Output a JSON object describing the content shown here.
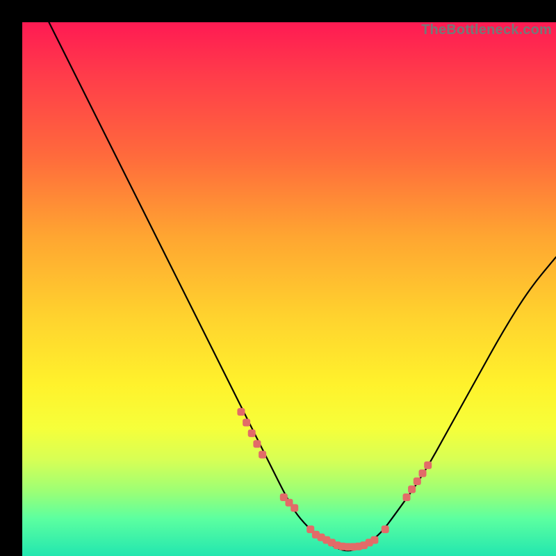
{
  "watermark": "TheBottleneck.com",
  "colors": {
    "background": "#000000",
    "curve": "#000000",
    "markers": "#e26b68",
    "gradient_top": "#ff1a53",
    "gradient_bottom": "#22e6b0"
  },
  "chart_data": {
    "type": "line",
    "title": "",
    "xlabel": "",
    "ylabel": "",
    "xlim": [
      0,
      100
    ],
    "ylim": [
      0,
      100
    ],
    "series": [
      {
        "name": "bottleneck-curve",
        "x": [
          5,
          10,
          15,
          20,
          25,
          30,
          35,
          40,
          45,
          50,
          52,
          55,
          58,
          60,
          62,
          64,
          67,
          70,
          75,
          80,
          85,
          90,
          95,
          100
        ],
        "y": [
          100,
          90,
          80,
          70,
          60,
          50,
          40,
          30,
          20,
          10,
          7,
          4,
          2,
          1,
          1,
          2,
          4,
          8,
          15,
          24,
          33,
          42,
          50,
          56
        ]
      }
    ],
    "markers": {
      "name": "highlighted-points",
      "x": [
        41,
        42,
        43,
        44,
        45,
        49,
        50,
        51,
        54,
        55,
        56,
        57,
        58,
        59,
        60,
        61,
        62,
        63,
        64,
        65,
        66,
        68,
        72,
        73,
        74,
        75,
        76
      ],
      "y": [
        27,
        25,
        23,
        21,
        19,
        11,
        10,
        9,
        5,
        4,
        3.5,
        3,
        2.5,
        2,
        1.8,
        1.7,
        1.7,
        1.8,
        2,
        2.5,
        3,
        5,
        11,
        12.5,
        14,
        15.5,
        17
      ]
    }
  }
}
